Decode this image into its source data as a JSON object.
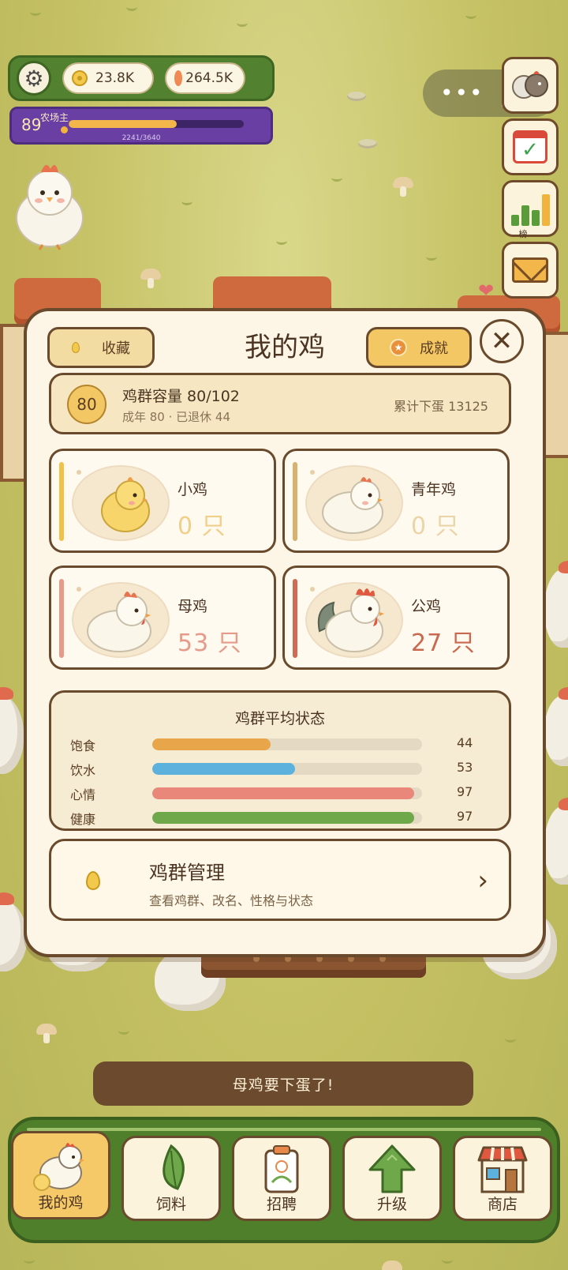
{
  "hud": {
    "gold": "23.8K",
    "gems": "264.5K",
    "level": "89",
    "level_title": "农场主",
    "xp_text": "2241/3640",
    "xp_progress": 0.616
  },
  "side_buttons": {
    "rank_label": "榜"
  },
  "modal": {
    "title": "我的鸡",
    "favorites_label": "收藏",
    "achievements_label": "成就",
    "close_glyph": "✕",
    "capacity": {
      "badge": "80",
      "main": "鸡群容量 80/102",
      "sub": "成年 80 · 已退休 44",
      "total_eggs": "累计下蛋 13125"
    },
    "categories": [
      {
        "name": "小鸡",
        "count": "0 只",
        "accent": "#f0c24a",
        "count_color": "#f0cf8a"
      },
      {
        "name": "青年鸡",
        "count": "0 只",
        "accent": "#d8b070",
        "count_color": "#ead5a8"
      },
      {
        "name": "母鸡",
        "count": "53 只",
        "accent": "#e89a8a",
        "count_color": "#e59a8a"
      },
      {
        "name": "公鸡",
        "count": "27 只",
        "accent": "#cf6a55",
        "count_color": "#c96a50"
      }
    ],
    "stats": {
      "title": "鸡群平均状态",
      "rows": [
        {
          "label": "饱食",
          "value": "44",
          "fraction": 0.44,
          "color": "#e9a54a"
        },
        {
          "label": "饮水",
          "value": "53",
          "fraction": 0.53,
          "color": "#5cb2dd"
        },
        {
          "label": "心情",
          "value": "97",
          "fraction": 0.97,
          "color": "#e8877a"
        },
        {
          "label": "健康",
          "value": "97",
          "fraction": 0.97,
          "color": "#6fa84a"
        }
      ]
    },
    "manage": {
      "title": "鸡群管理",
      "subtitle": "查看鸡群、改名、性格与状态",
      "chevron": "›"
    }
  },
  "toast": "母鸡要下蛋了!",
  "nav": [
    {
      "label": "我的鸡",
      "icon": "chicken-icon"
    },
    {
      "label": "饲料",
      "icon": "leaf-icon"
    },
    {
      "label": "招聘",
      "icon": "badge-icon"
    },
    {
      "label": "升级",
      "icon": "arrow-up-icon"
    },
    {
      "label": "商店",
      "icon": "shop-icon"
    }
  ]
}
